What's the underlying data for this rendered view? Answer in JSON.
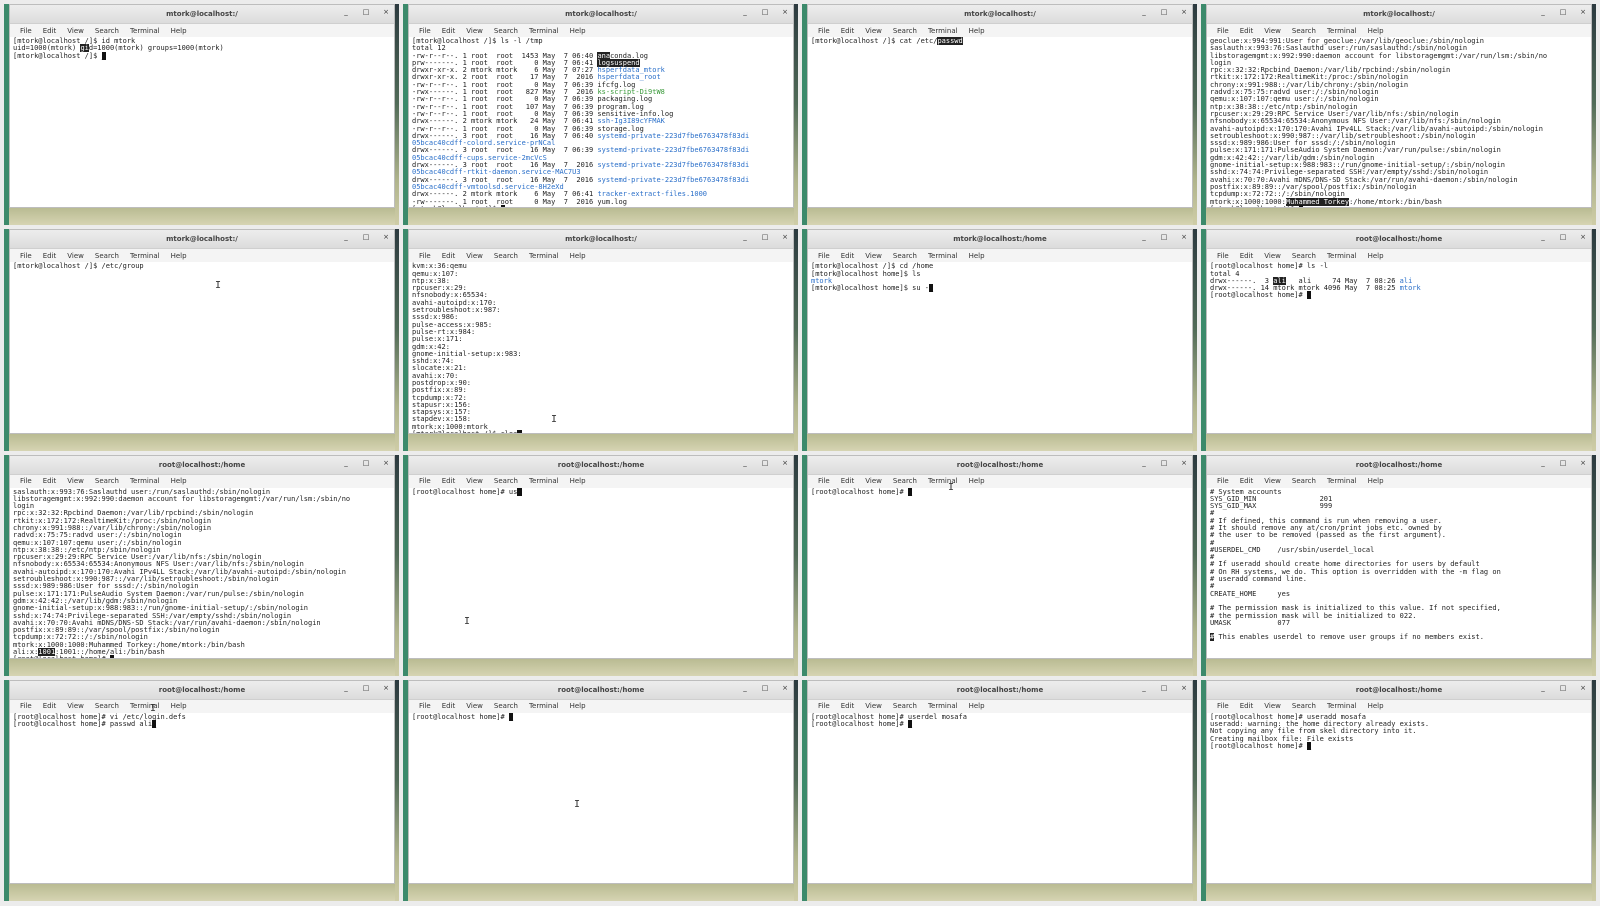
{
  "menu": [
    "File",
    "Edit",
    "View",
    "Search",
    "Terminal",
    "Help"
  ],
  "window_controls": [
    "_",
    "□",
    "×"
  ],
  "tiles": [
    {
      "title": "mtork@localhost:/",
      "lines": [
        [
          {
            "t": "[mtork@localhost /]$ id mtork"
          }
        ],
        [
          {
            "t": "uid=1000(mtork) "
          },
          {
            "t": "gi",
            "c": "hl"
          },
          {
            "t": "d=1000(mtork) groups=1000(mtork)"
          }
        ],
        [
          {
            "t": "[mtork@localhost /]$ "
          },
          {
            "t": "_",
            "c": "cursor"
          }
        ]
      ]
    },
    {
      "title": "mtork@localhost:/",
      "lines": [
        [
          {
            "t": "[mtork@localhost /]$ ls -l /tmp"
          }
        ],
        [
          {
            "t": "total 12"
          }
        ],
        [
          {
            "t": "-rw-r--r--. 1 root  root  1453 May  7 06:40 "
          },
          {
            "t": "ana",
            "c": "hl"
          },
          {
            "t": "conda.log"
          }
        ],
        [
          {
            "t": "prw-------. 1 root  root     0 May  7 06:41 "
          },
          {
            "t": "logsuspend",
            "c": "hl"
          }
        ],
        [
          {
            "t": "drwxr-xr-x. 2 mtork mtork    6 May  7 07:27 "
          },
          {
            "t": "hsperfdata_mtork",
            "c": "blue"
          }
        ],
        [
          {
            "t": "drwxr-xr-x. 2 root  root    17 May  7  2016 "
          },
          {
            "t": "hsperfdata_root",
            "c": "blue"
          }
        ],
        [
          {
            "t": "-rw-r--r--. 1 root  root     0 May  7 06:39 ifcfg.log"
          }
        ],
        [
          {
            "t": "-rwx------. 1 root  root   827 May  7  2016 "
          },
          {
            "t": "ks-script-Di9tW8",
            "c": "green"
          }
        ],
        [
          {
            "t": "-rw-r--r--. 1 root  root     0 May  7 06:39 packaging.log"
          }
        ],
        [
          {
            "t": "-rw-r--r--. 1 root  root   107 May  7 06:39 program.log"
          }
        ],
        [
          {
            "t": "-rw-r--r--. 1 root  root     0 May  7 06:39 sensitive-info.log"
          }
        ],
        [
          {
            "t": "drwx------. 2 mtork mtork   24 May  7 06:41 "
          },
          {
            "t": "ssh-Ig3I89cYFMAK",
            "c": "blue"
          }
        ],
        [
          {
            "t": "-rw-r--r--. 1 root  root     0 May  7 06:39 storage.log"
          }
        ],
        [
          {
            "t": "drwx------. 3 root  root    16 May  7 06:40 "
          },
          {
            "t": "systemd-private-223d7fbe6763478f83di",
            "c": "blue"
          }
        ],
        [
          {
            "t": "05bcac40cdff-colord.service-prNCal",
            "c": "blue"
          }
        ],
        [
          {
            "t": "drwx------. 3 root  root    16 May  7 06:39 "
          },
          {
            "t": "systemd-private-223d7fbe6763478f83di",
            "c": "blue"
          }
        ],
        [
          {
            "t": "05bcac40cdff-cups.service-2mcVcS",
            "c": "blue"
          }
        ],
        [
          {
            "t": "drwx------. 3 root  root    16 May  7  2016 "
          },
          {
            "t": "systemd-private-223d7fbe6763478f83di",
            "c": "blue"
          }
        ],
        [
          {
            "t": "05bcac40cdff-rtkit-daemon.service-MAC7U3",
            "c": "blue"
          }
        ],
        [
          {
            "t": "drwx------. 3 root  root    16 May  7  2016 "
          },
          {
            "t": "systemd-private-223d7fbe6763478f83di",
            "c": "blue"
          }
        ],
        [
          {
            "t": "05bcac40cdff-vmtoolsd.service-8H2eXd",
            "c": "blue"
          }
        ],
        [
          {
            "t": "drwx------. 2 mtork mtork    6 May  7 06:41 "
          },
          {
            "t": "tracker-extract-files.1000",
            "c": "blue"
          }
        ],
        [
          {
            "t": "-rw-------. 1 root  root     0 May  7  2016 yum.log"
          }
        ],
        [
          {
            "t": "[mtork@localhost /]$ "
          },
          {
            "t": "_",
            "c": "cursor"
          }
        ]
      ]
    },
    {
      "title": "mtork@localhost:/",
      "lines": [
        [
          {
            "t": "[mtork@localhost /]$ cat /etc/"
          },
          {
            "t": "passwd",
            "c": "hl"
          }
        ]
      ]
    },
    {
      "title": "mtork@localhost:/",
      "lines": [
        [
          {
            "t": "geoclue:x:994:991:User for geoclue:/var/lib/geoclue:/sbin/nologin"
          }
        ],
        [
          {
            "t": "saslauth:x:993:76:Saslauthd user:/run/saslauthd:/sbin/nologin"
          }
        ],
        [
          {
            "t": "libstoragemgmt:x:992:990:daemon account for libstoragemgmt:/var/run/lsm:/sbin/no"
          }
        ],
        [
          {
            "t": "login"
          }
        ],
        [
          {
            "t": "rpc:x:32:32:Rpcbind Daemon:/var/lib/rpcbind:/sbin/nologin"
          }
        ],
        [
          {
            "t": "rtkit:x:172:172:RealtimeKit:/proc:/sbin/nologin"
          }
        ],
        [
          {
            "t": "chrony:x:991:988::/var/lib/chrony:/sbin/nologin"
          }
        ],
        [
          {
            "t": "radvd:x:75:75:radvd user:/:/sbin/nologin"
          }
        ],
        [
          {
            "t": "qemu:x:107:107:qemu user:/:/sbin/nologin"
          }
        ],
        [
          {
            "t": "ntp:x:38:38::/etc/ntp:/sbin/nologin"
          }
        ],
        [
          {
            "t": "rpcuser:x:29:29:RPC Service User:/var/lib/nfs:/sbin/nologin"
          }
        ],
        [
          {
            "t": "nfsnobody:x:65534:65534:Anonymous NFS User:/var/lib/nfs:/sbin/nologin"
          }
        ],
        [
          {
            "t": "avahi-autoipd:x:170:170:Avahi IPv4LL Stack:/var/lib/avahi-autoipd:/sbin/nologin"
          }
        ],
        [
          {
            "t": "setroubleshoot:x:990:987::/var/lib/setroubleshoot:/sbin/nologin"
          }
        ],
        [
          {
            "t": "sssd:x:989:986:User for sssd:/:/sbin/nologin"
          }
        ],
        [
          {
            "t": "pulse:x:171:171:PulseAudio System Daemon:/var/run/pulse:/sbin/nologin"
          }
        ],
        [
          {
            "t": "gdm:x:42:42::/var/lib/gdm:/sbin/nologin"
          }
        ],
        [
          {
            "t": "gnome-initial-setup:x:988:983::/run/gnome-initial-setup/:/sbin/nologin"
          }
        ],
        [
          {
            "t": "sshd:x:74:74:Privilege-separated SSH:/var/empty/sshd:/sbin/nologin"
          }
        ],
        [
          {
            "t": "avahi:x:70:70:Avahi mDNS/DNS-SD Stack:/var/run/avahi-daemon:/sbin/nologin"
          }
        ],
        [
          {
            "t": "postfix:x:89:89::/var/spool/postfix:/sbin/nologin"
          }
        ],
        [
          {
            "t": "tcpdump:x:72:72::/:/sbin/nologin"
          }
        ],
        [
          {
            "t": "mtork:x:1000:1000:"
          },
          {
            "t": "Muhammed Torkey",
            "c": "hl"
          },
          {
            "t": ":/home/mtork:/bin/bash"
          }
        ],
        [
          {
            "t": "[mtork@localhost /]$ "
          },
          {
            "t": "_",
            "c": "cursor"
          }
        ]
      ]
    },
    {
      "title": "mtork@localhost:/",
      "lines": [
        [
          {
            "t": "[mtork@localhost /]$ /etc/group"
          }
        ]
      ],
      "ibeam": [
        205,
        50
      ]
    },
    {
      "title": "mtork@localhost:/",
      "lines": [
        [
          {
            "t": "kvm:x:36:qemu"
          }
        ],
        [
          {
            "t": "qemu:x:107:"
          }
        ],
        [
          {
            "t": "ntp:x:38:"
          }
        ],
        [
          {
            "t": "rpcuser:x:29:"
          }
        ],
        [
          {
            "t": "nfsnobody:x:65534:"
          }
        ],
        [
          {
            "t": "avahi-autoipd:x:170:"
          }
        ],
        [
          {
            "t": "setroubleshoot:x:987:"
          }
        ],
        [
          {
            "t": "sssd:x:986:"
          }
        ],
        [
          {
            "t": "pulse-access:x:985:"
          }
        ],
        [
          {
            "t": "pulse-rt:x:984:"
          }
        ],
        [
          {
            "t": "pulse:x:171:"
          }
        ],
        [
          {
            "t": "gdm:x:42:"
          }
        ],
        [
          {
            "t": "gnome-initial-setup:x:983:"
          }
        ],
        [
          {
            "t": "sshd:x:74:"
          }
        ],
        [
          {
            "t": "slocate:x:21:"
          }
        ],
        [
          {
            "t": "avahi:x:70:"
          }
        ],
        [
          {
            "t": "postdrop:x:90:"
          }
        ],
        [
          {
            "t": "postfix:x:89:"
          }
        ],
        [
          {
            "t": "tcpdump:x:72:"
          }
        ],
        [
          {
            "t": "stapusr:x:156:"
          }
        ],
        [
          {
            "t": "stapsys:x:157:"
          }
        ],
        [
          {
            "t": "stapdev:x:158:"
          }
        ],
        [
          {
            "t": "mtork:x:1000:mtork"
          }
        ],
        [
          {
            "t": "[mtork@localhost /]$ clea"
          },
          {
            "t": "_",
            "c": "cursor"
          }
        ]
      ],
      "ibeam": [
        142,
        184
      ]
    },
    {
      "title": "mtork@localhost:/home",
      "lines": [
        [
          {
            "t": "[mtork@localhost /]$ cd /home"
          }
        ],
        [
          {
            "t": "[mtork@localhost home]$ ls"
          }
        ],
        [
          {
            "t": "mtork",
            "c": "blue"
          }
        ],
        [
          {
            "t": "[mtork@localhost home]$ su -"
          },
          {
            "t": "_",
            "c": "cursor"
          }
        ]
      ]
    },
    {
      "title": "root@localhost:/home",
      "lines": [
        [
          {
            "t": "[root@localhost home]# ls -l"
          }
        ],
        [
          {
            "t": "total 4"
          }
        ],
        [
          {
            "t": "drwx------.  3 "
          },
          {
            "t": "ali",
            "c": "hl"
          },
          {
            "t": "   ali     74 May  7 08:26 "
          },
          {
            "t": "ali",
            "c": "blue"
          }
        ],
        [
          {
            "t": "drwx------. 14 mtork mtork 4096 May  7 08:25 "
          },
          {
            "t": "mtork",
            "c": "blue"
          }
        ],
        [
          {
            "t": "[root@localhost home]# "
          },
          {
            "t": "_",
            "c": "cursor"
          }
        ]
      ]
    },
    {
      "title": "root@localhost:/home",
      "lines": [
        [
          {
            "t": "saslauth:x:993:76:Saslauthd user:/run/saslauthd:/sbin/nologin"
          }
        ],
        [
          {
            "t": "libstoragemgmt:x:992:990:daemon account for libstoragemgmt:/var/run/lsm:/sbin/no"
          }
        ],
        [
          {
            "t": "login"
          }
        ],
        [
          {
            "t": "rpc:x:32:32:Rpcbind Daemon:/var/lib/rpcbind:/sbin/nologin"
          }
        ],
        [
          {
            "t": "rtkit:x:172:172:RealtimeKit:/proc:/sbin/nologin"
          }
        ],
        [
          {
            "t": "chrony:x:991:988::/var/lib/chrony:/sbin/nologin"
          }
        ],
        [
          {
            "t": "radvd:x:75:75:radvd user:/:/sbin/nologin"
          }
        ],
        [
          {
            "t": "qemu:x:107:107:qemu user:/:/sbin/nologin"
          }
        ],
        [
          {
            "t": "ntp:x:38:38::/etc/ntp:/sbin/nologin"
          }
        ],
        [
          {
            "t": "rpcuser:x:29:29:RPC Service User:/var/lib/nfs:/sbin/nologin"
          }
        ],
        [
          {
            "t": "nfsnobody:x:65534:65534:Anonymous NFS User:/var/lib/nfs:/sbin/nologin"
          }
        ],
        [
          {
            "t": "avahi-autoipd:x:170:170:Avahi IPv4LL Stack:/var/lib/avahi-autoipd:/sbin/nologin"
          }
        ],
        [
          {
            "t": "setroubleshoot:x:990:987::/var/lib/setroubleshoot:/sbin/nologin"
          }
        ],
        [
          {
            "t": "sssd:x:989:986:User for sssd:/:/sbin/nologin"
          }
        ],
        [
          {
            "t": "pulse:x:171:171:PulseAudio System Daemon:/var/run/pulse:/sbin/nologin"
          }
        ],
        [
          {
            "t": "gdm:x:42:42::/var/lib/gdm:/sbin/nologin"
          }
        ],
        [
          {
            "t": "gnome-initial-setup:x:988:983::/run/gnome-initial-setup/:/sbin/nologin"
          }
        ],
        [
          {
            "t": "sshd:x:74:74:Privilege-separated SSH:/var/empty/sshd:/sbin/nologin"
          }
        ],
        [
          {
            "t": "avahi:x:70:70:Avahi mDNS/DNS-SD Stack:/var/run/avahi-daemon:/sbin/nologin"
          }
        ],
        [
          {
            "t": "postfix:x:89:89::/var/spool/postfix:/sbin/nologin"
          }
        ],
        [
          {
            "t": "tcpdump:x:72:72::/:/sbin/nologin"
          }
        ],
        [
          {
            "t": "mtork:x:1000:1000:Muhammed Torkey:/home/mtork:/bin/bash"
          }
        ],
        [
          {
            "t": "ali:x:"
          },
          {
            "t": "1001",
            "c": "hl"
          },
          {
            "t": ":1001::/home/ali:/bin/bash"
          }
        ],
        [
          {
            "t": "[root@localhost home]# "
          },
          {
            "t": "_",
            "c": "cursor"
          }
        ]
      ]
    },
    {
      "title": "root@localhost:/home",
      "lines": [
        [
          {
            "t": "[root@localhost home]# us"
          },
          {
            "t": "_",
            "c": "cursor"
          }
        ]
      ],
      "ibeam": [
        55,
        160
      ]
    },
    {
      "title": "root@localhost:/home",
      "lines": [
        [
          {
            "t": "[root@localhost home]# "
          },
          {
            "t": "_",
            "c": "cursor"
          }
        ]
      ],
      "ibeam": [
        140,
        26
      ]
    },
    {
      "title": "root@localhost:/home",
      "lines": [
        [
          {
            "t": "# System accounts"
          }
        ],
        [
          {
            "t": "SYS_GID_MIN               201"
          }
        ],
        [
          {
            "t": "SYS_GID_MAX               999"
          }
        ],
        [
          {
            "t": "#"
          }
        ],
        [
          {
            "t": "# If defined, this command is run when removing a user."
          }
        ],
        [
          {
            "t": "# It should remove any at/cron/print jobs etc. owned by"
          }
        ],
        [
          {
            "t": "# the user to be removed (passed as the first argument)."
          }
        ],
        [
          {
            "t": "#"
          }
        ],
        [
          {
            "t": "#USERDEL_CMD    /usr/sbin/userdel_local"
          }
        ],
        [
          {
            "t": "#"
          }
        ],
        [
          {
            "t": "# If useradd should create home directories for users by default"
          }
        ],
        [
          {
            "t": "# On RH systems, we do. This option is overridden with the -m flag on"
          }
        ],
        [
          {
            "t": "# useradd command line."
          }
        ],
        [
          {
            "t": "#"
          }
        ],
        [
          {
            "t": "CREATE_HOME     yes"
          }
        ],
        [
          {
            "t": ""
          }
        ],
        [
          {
            "t": "# The permission mask is initialized to this value. If not specified,"
          }
        ],
        [
          {
            "t": "# the permission mask will be initialized to 022."
          }
        ],
        [
          {
            "t": "UMASK           077"
          }
        ],
        [
          {
            "t": ""
          }
        ],
        [
          {
            "t": "#",
            "c": "hl"
          },
          {
            "t": " This enables userdel to remove user groups if no members exist."
          }
        ]
      ]
    },
    {
      "title": "root@localhost:/home",
      "lines": [
        [
          {
            "t": "[root@localhost home]# vi /etc/login.defs"
          }
        ],
        [
          {
            "t": "[root@localhost home]# passwd ali"
          },
          {
            "t": "_",
            "c": "cursor"
          }
        ]
      ],
      "ibeam": [
        140,
        22
      ]
    },
    {
      "title": "root@localhost:/home",
      "lines": [
        [
          {
            "t": "[root@localhost home]# "
          },
          {
            "t": "_",
            "c": "cursor"
          }
        ]
      ],
      "ibeam": [
        165,
        118
      ]
    },
    {
      "title": "root@localhost:/home",
      "lines": [
        [
          {
            "t": "[root@localhost home]# userdel mosafa"
          }
        ],
        [
          {
            "t": "[root@localhost home]# "
          },
          {
            "t": "_",
            "c": "cursor"
          }
        ]
      ]
    },
    {
      "title": "root@localhost:/home",
      "lines": [
        [
          {
            "t": "[root@localhost home]# useradd mosafa"
          }
        ],
        [
          {
            "t": "useradd: warning: the home directory already exists."
          }
        ],
        [
          {
            "t": "Not copying any file from skel directory into it."
          }
        ],
        [
          {
            "t": "Creating mailbox file: File exists"
          }
        ],
        [
          {
            "t": "[root@localhost home]# "
          },
          {
            "t": "_",
            "c": "cursor"
          }
        ]
      ]
    }
  ]
}
